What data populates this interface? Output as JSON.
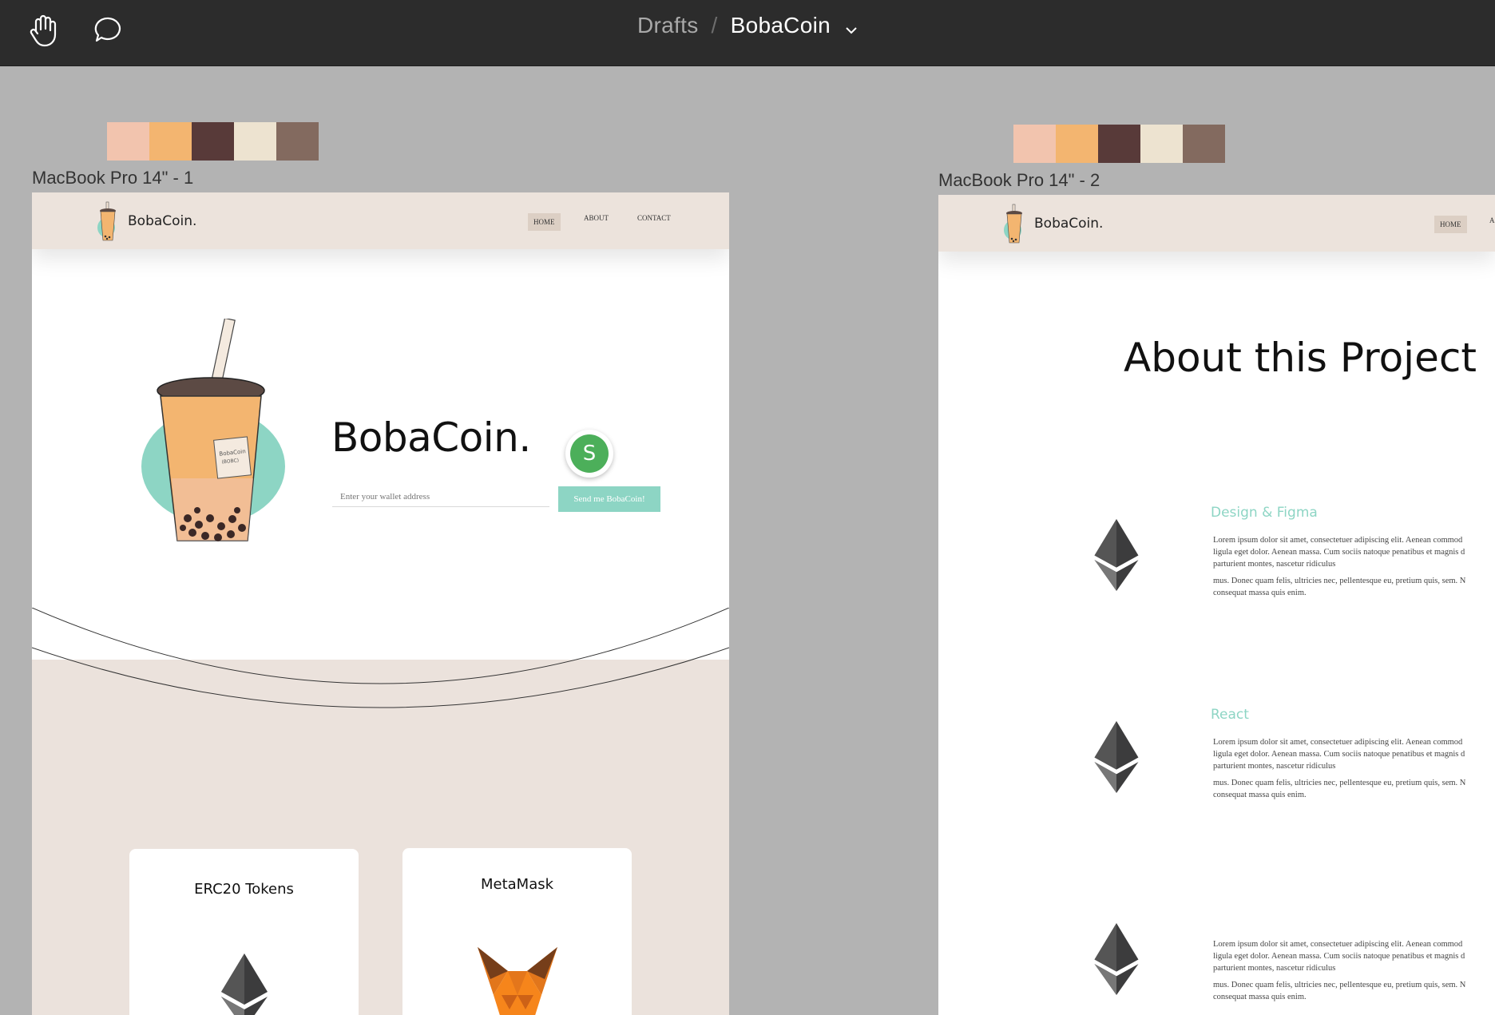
{
  "breadcrumb": {
    "folder": "Drafts",
    "separator": "/",
    "file": "BobaCoin"
  },
  "palette": [
    "#f2c4ae",
    "#f3b570",
    "#583a39",
    "#ede3d0",
    "#836a5f"
  ],
  "frames": [
    {
      "label": "MacBook Pro 14\" - 1",
      "brand": "BobaCoin.",
      "nav": [
        "HOME",
        "ABOUT",
        "CONTACT"
      ],
      "hero_title": "BobaCoin.",
      "wallet_placeholder": "Enter your wallet address",
      "send_button": "Send me BobaCoin!",
      "avatar_initial": "S",
      "cards": [
        "ERC20 Tokens",
        "MetaMask"
      ]
    },
    {
      "label": "MacBook Pro 14\" - 2",
      "brand": "BobaCoin.",
      "nav": [
        "HOME"
      ],
      "about_title": "About this Project",
      "sections": [
        {
          "title": "Design & Figma",
          "lines": [
            "Lorem ipsum dolor sit amet, consectetuer adipiscing elit. Aenean commod",
            "ligula eget dolor. Aenean massa. Cum sociis natoque penatibus et magnis d",
            "parturient montes, nascetur ridiculus"
          ],
          "lines2": [
            "mus. Donec quam felis, ultricies nec, pellentesque eu, pretium quis, sem. N",
            "consequat massa quis enim."
          ]
        },
        {
          "title": "React",
          "lines": [
            "Lorem ipsum dolor sit amet, consectetuer adipiscing elit. Aenean commod",
            "ligula eget dolor. Aenean massa. Cum sociis natoque penatibus et magnis d",
            "parturient montes, nascetur ridiculus"
          ],
          "lines2": [
            "mus. Donec quam felis, ultricies nec, pellentesque eu, pretium quis, sem. N",
            "consequat massa quis enim."
          ]
        },
        {
          "title": "",
          "lines": [
            "Lorem ipsum dolor sit amet, consectetuer adipiscing elit. Aenean commod",
            "ligula eget dolor. Aenean massa. Cum sociis natoque penatibus et magnis d",
            "parturient montes, nascetur ridiculus"
          ],
          "lines2": [
            "mus. Donec quam felis, ultricies nec, pellentesque eu, pretium quis, sem. N",
            "consequat massa quis enim."
          ]
        }
      ]
    }
  ]
}
